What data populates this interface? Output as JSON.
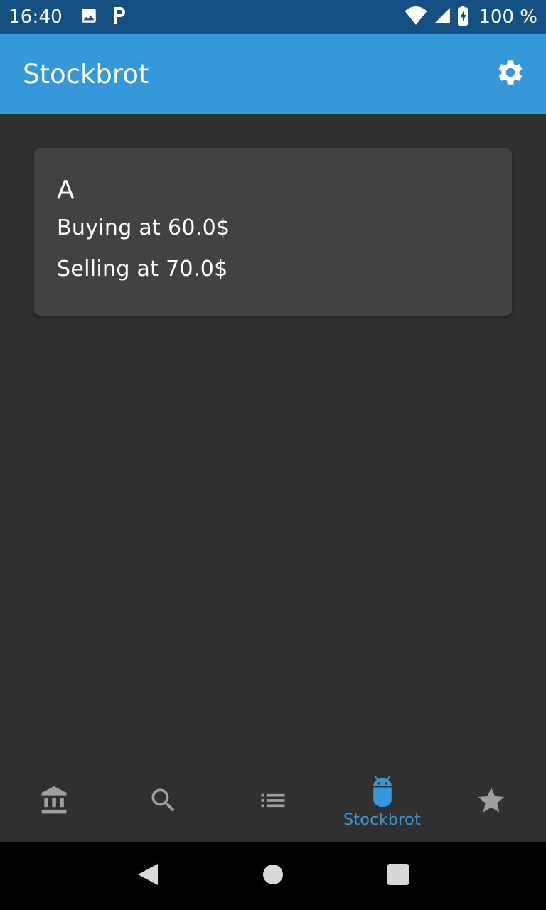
{
  "status_bar": {
    "time": "16:40",
    "battery": "100 %",
    "icons": [
      "image-icon",
      "parking-icon",
      "wifi-icon",
      "signal-icon",
      "battery-charging-icon"
    ]
  },
  "app_bar": {
    "title": "Stockbrot",
    "settings_icon": "gear-icon"
  },
  "card": {
    "symbol": "A",
    "buying": "Buying at 60.0$",
    "selling": "Selling at 70.0$"
  },
  "bottom_nav": {
    "active_color": "#3598DB",
    "inactive_color": "#9E9E9E",
    "items": [
      {
        "icon": "bank-icon",
        "label": "",
        "active": false
      },
      {
        "icon": "search-icon",
        "label": "",
        "active": false
      },
      {
        "icon": "list-icon",
        "label": "",
        "active": false
      },
      {
        "icon": "android-icon",
        "label": "Stockbrot",
        "active": true
      },
      {
        "icon": "star-icon",
        "label": "",
        "active": false
      }
    ]
  },
  "system_nav": {
    "icons": [
      "back-icon",
      "home-icon",
      "recents-icon"
    ]
  },
  "colors": {
    "status_bar": "#145082",
    "app_bar": "#3598DB",
    "background": "#303030",
    "card": "#424242"
  }
}
